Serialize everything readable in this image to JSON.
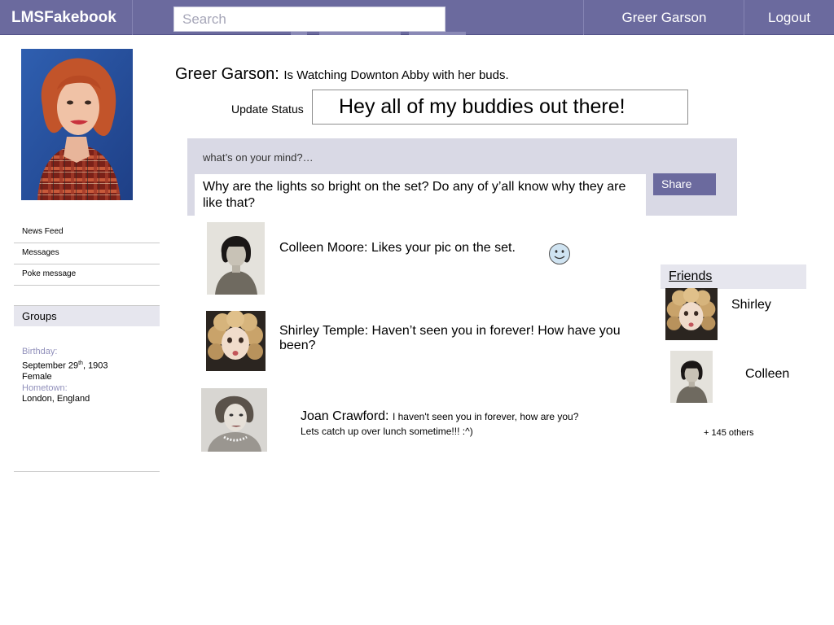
{
  "header": {
    "brand": "LMSFakebook",
    "search_placeholder": "Search",
    "user_name": "Greer Garson",
    "logout_label": "Logout"
  },
  "sidebar": {
    "items": [
      {
        "label": "News Feed"
      },
      {
        "label": "Messages"
      },
      {
        "label": "Poke message"
      }
    ],
    "groups_label": "Groups",
    "info": {
      "birthday_label": "Birthday:",
      "birthday_day": "September 29",
      "birthday_suffix": "th",
      "birthday_year": ", 1903",
      "gender": "Female",
      "hometown_label": "Hometown:",
      "hometown": "London, England"
    }
  },
  "status": {
    "name": "Greer Garson:",
    "text": "Is Watching Downton Abby with her buds.",
    "update_label": "Update Status",
    "update_value": "Hey all of my buddies out there!"
  },
  "composer": {
    "prompt": "what’s on your mind?…",
    "text": "Why are the lights so bright on the set?  Do any of y’all know why they are like that?",
    "share_label": "Share"
  },
  "feed": [
    {
      "name": "Colleen Moore:",
      "message": "Likes your pic on the set."
    },
    {
      "name": "Shirley Temple:",
      "message": "Haven’t seen you in forever!  How have you been?"
    },
    {
      "name": "Joan Crawford:",
      "message": "I haven't seen you in forever, how are you?  Lets catch up over lunch sometime!!! :^)"
    }
  ],
  "friends": {
    "header": "Friends",
    "list": [
      {
        "name": "Shirley"
      },
      {
        "name": "Colleen"
      }
    ],
    "others": "+ 145 others"
  },
  "colors": {
    "brand": "#6b6a9e",
    "panel": "#d9d9e5",
    "label": "#9190bb"
  }
}
